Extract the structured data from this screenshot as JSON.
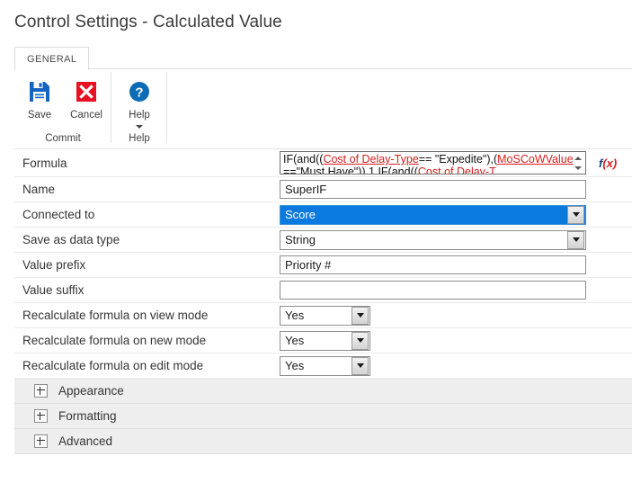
{
  "page": {
    "title": "Control Settings - Calculated Value"
  },
  "ribbon": {
    "tabs": [
      {
        "label": "GENERAL",
        "selected": true
      }
    ],
    "groups": [
      {
        "title": "Commit",
        "buttons": [
          {
            "label": "Save",
            "icon": "save-floppy-icon"
          },
          {
            "label": "Cancel",
            "icon": "cancel-x-icon"
          }
        ]
      },
      {
        "title": "Help",
        "buttons": [
          {
            "label": "Help",
            "icon": "help-question-icon",
            "has_caret": true
          }
        ]
      }
    ]
  },
  "form": {
    "formula": {
      "label": "Formula",
      "line1_parts": [
        {
          "text": "IF(and((",
          "type": "plain"
        },
        {
          "text": "Cost of Delay-Type",
          "type": "ref"
        },
        {
          "text": "== \"Expedite\"),(",
          "type": "plain"
        },
        {
          "text": "MoSCoWValue",
          "type": "ref"
        }
      ],
      "line2_parts": [
        {
          "text": "==\"Must Have\")),1,IF(and((",
          "type": "plain"
        },
        {
          "text": "Cost of Delay-T",
          "type": "ref"
        }
      ],
      "fx_label": "f(x)"
    },
    "name": {
      "label": "Name",
      "value": "SuperIF"
    },
    "connected_to": {
      "label": "Connected to",
      "value": "Score",
      "focused": true
    },
    "save_as_data_type": {
      "label": "Save as data type",
      "value": "String"
    },
    "value_prefix": {
      "label": "Value prefix",
      "value": "Priority #"
    },
    "value_suffix": {
      "label": "Value suffix",
      "value": ""
    },
    "recalc_view": {
      "label": "Recalculate formula on view mode",
      "value": "Yes"
    },
    "recalc_new": {
      "label": "Recalculate formula on new mode",
      "value": "Yes"
    },
    "recalc_edit": {
      "label": "Recalculate formula on edit mode",
      "value": "Yes"
    }
  },
  "sections": [
    {
      "label": "Appearance"
    },
    {
      "label": "Formatting"
    },
    {
      "label": "Advanced"
    }
  ],
  "colors": {
    "save_blue": "#1565c0",
    "cancel_red": "#e81123",
    "help_blue": "#0b6cb5",
    "selection_blue": "#0a7ae0",
    "formula_ref_red": "#d81d1d"
  }
}
